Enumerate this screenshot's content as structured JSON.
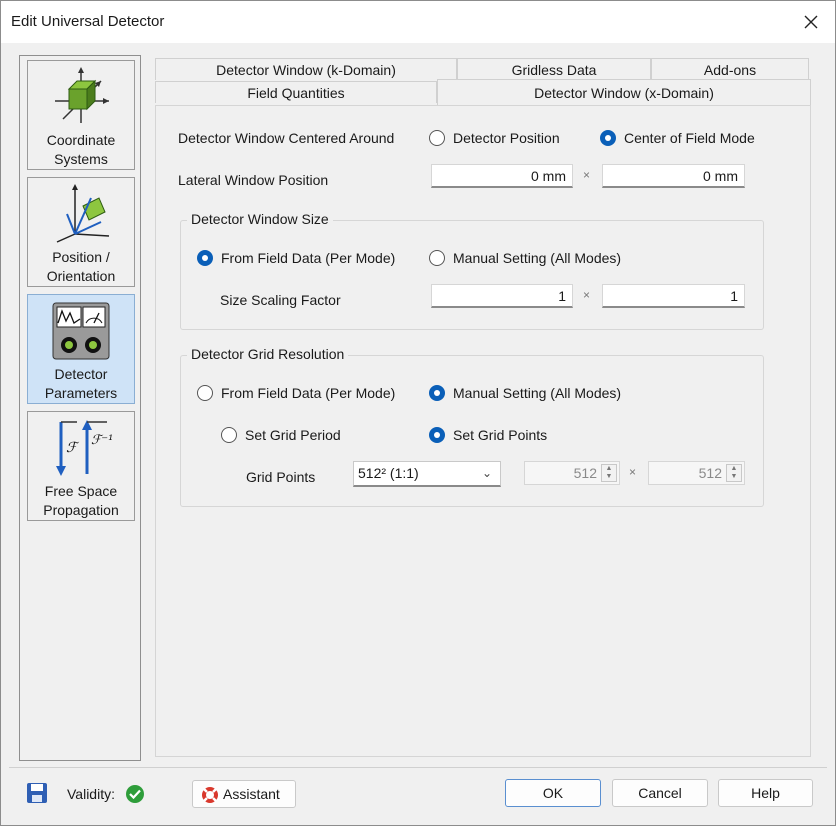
{
  "window": {
    "title": "Edit Universal Detector"
  },
  "sidebar": {
    "items": [
      {
        "label_line1": "Coordinate",
        "label_line2": "Systems",
        "icon": "coordinate-systems-icon"
      },
      {
        "label_line1": "Position /",
        "label_line2": "Orientation",
        "icon": "position-orientation-icon"
      },
      {
        "label_line1": "Detector",
        "label_line2": "Parameters",
        "icon": "detector-parameters-icon",
        "selected": true
      },
      {
        "label_line1": "Free Space",
        "label_line2": "Propagation",
        "icon": "free-space-propagation-icon"
      }
    ]
  },
  "tabs": {
    "row_back": [
      "Detector Window (k-Domain)",
      "Gridless Data",
      "Add-ons"
    ],
    "row_front": [
      "Field Quantities",
      "Detector Window (x-Domain)"
    ],
    "active": "Detector Window (x-Domain)"
  },
  "centered": {
    "label": "Detector Window Centered Around",
    "opt1": "Detector Position",
    "opt2": "Center of Field Mode",
    "selected": "Center of Field Mode"
  },
  "lateral": {
    "label": "Lateral Window Position",
    "x": "0 mm",
    "y": "0 mm",
    "sep": "×"
  },
  "window_size": {
    "title": "Detector Window Size",
    "opt1": "From Field Data (Per Mode)",
    "opt2": "Manual Setting (All Modes)",
    "selected": "From Field Data (Per Mode)",
    "scaling_label": "Size Scaling Factor",
    "scale_x": "1",
    "scale_y": "1",
    "sep": "×"
  },
  "grid_res": {
    "title": "Detector Grid Resolution",
    "opt1": "From Field Data (Per Mode)",
    "opt2": "Manual Setting (All Modes)",
    "selected": "Manual Setting (All Modes)",
    "sub_opt1": "Set Grid Period",
    "sub_opt2": "Set Grid Points",
    "sub_selected": "Set Grid Points",
    "points_label": "Grid Points",
    "points_select": "512² (1:1)",
    "points_x": "512",
    "points_y": "512",
    "sep": "×"
  },
  "bottom": {
    "validity_label": "Validity:",
    "assistant": "Assistant",
    "ok": "OK",
    "cancel": "Cancel",
    "help": "Help"
  },
  "colors": {
    "accent": "#0a5fb8",
    "selected_bg": "#cfe3f7",
    "valid_green": "#2e9d3a"
  }
}
